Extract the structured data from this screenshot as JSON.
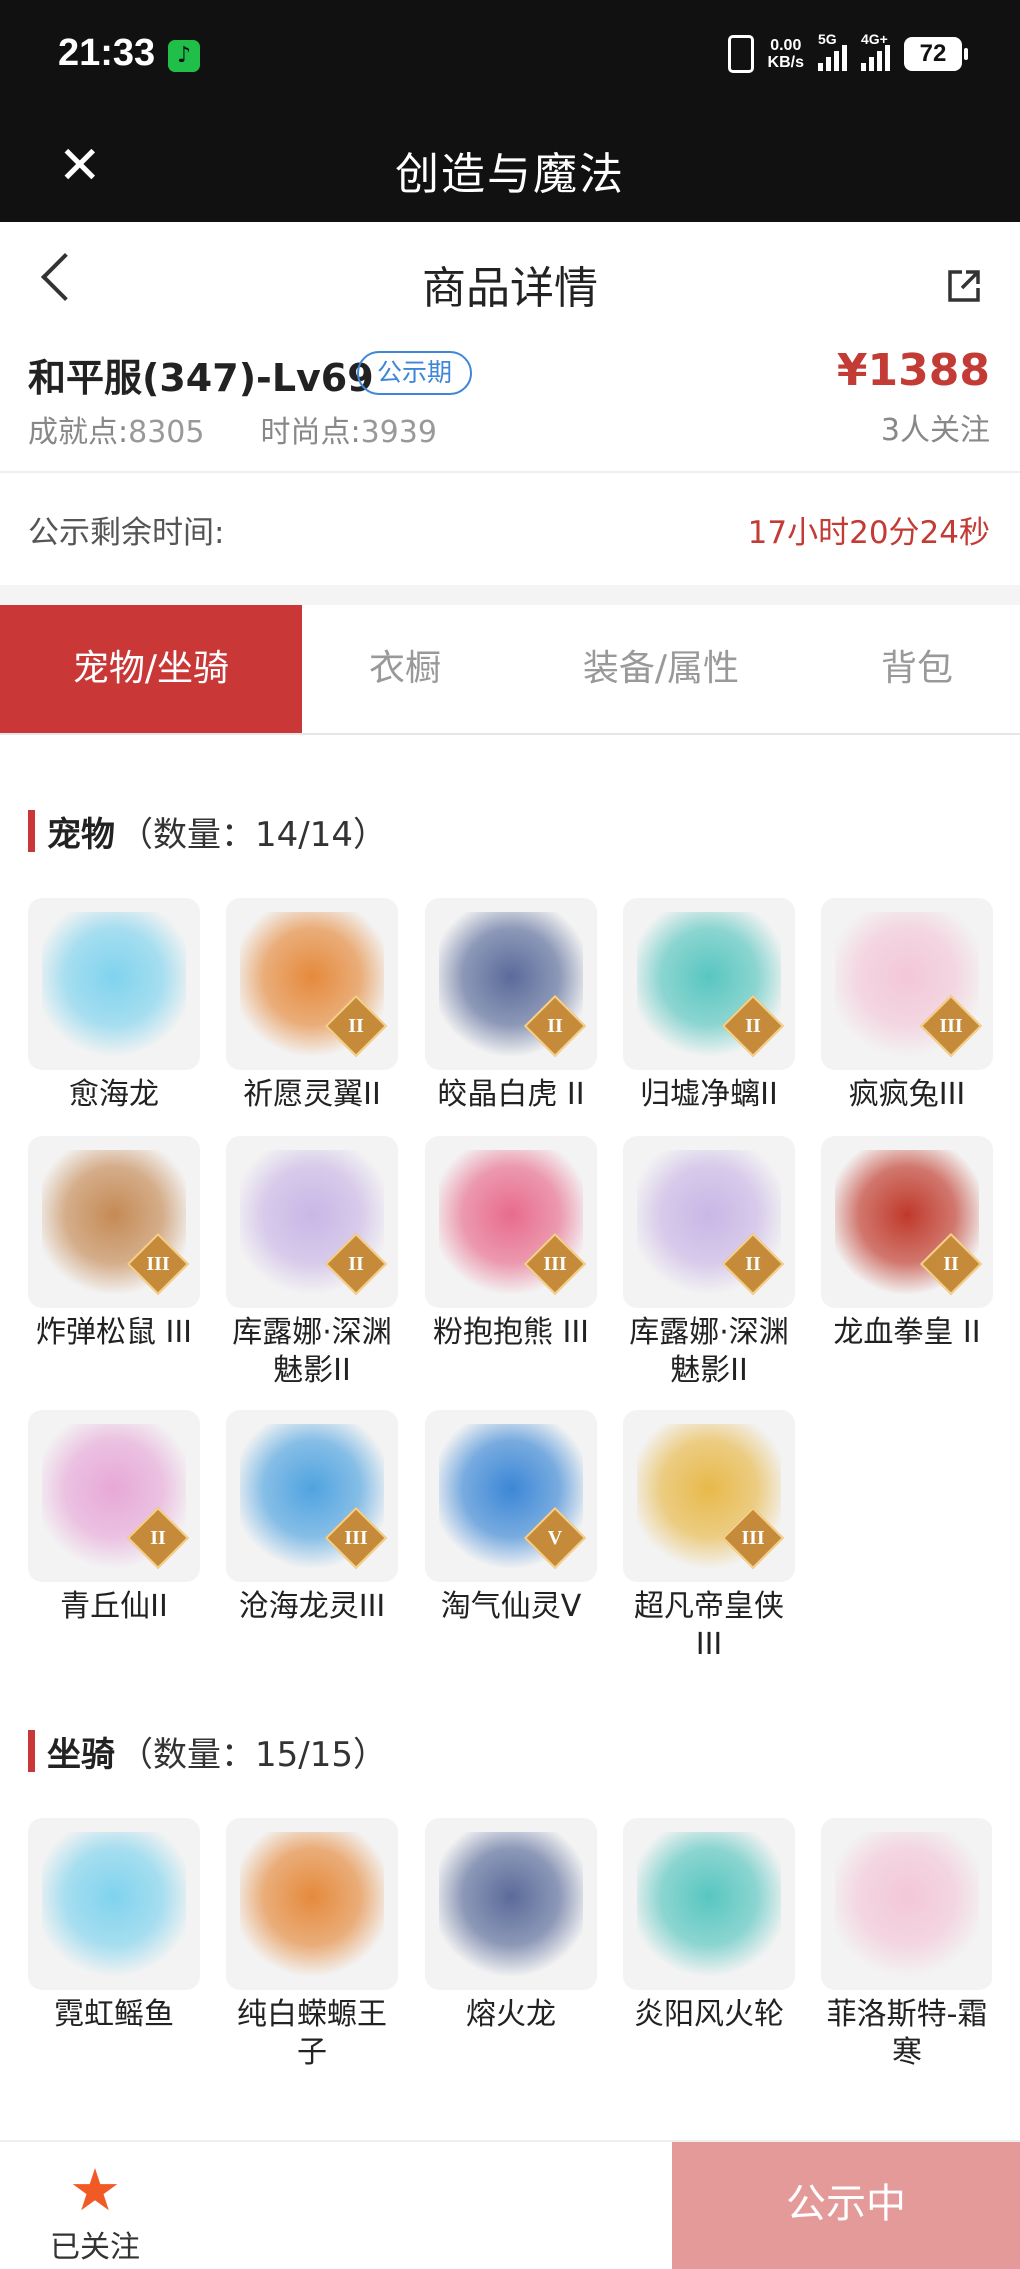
{
  "status_bar": {
    "time": "21:33",
    "net_speed_value": "0.00",
    "net_speed_unit": "KB/s",
    "signal1_label": "5G",
    "signal2_label": "4G+",
    "battery": "72"
  },
  "app_bar": {
    "title": "创造与魔法"
  },
  "nav": {
    "title": "商品详情"
  },
  "summary": {
    "name": "和平服(347)-Lv69",
    "badge": "公示期",
    "achievement_label": "成就点:",
    "achievement_value": "8305",
    "fashion_label": "时尚点:",
    "fashion_value": "3939",
    "price": "¥1388",
    "followers": "3人关注"
  },
  "countdown": {
    "label": "公示剩余时间:",
    "value": "17小时20分24秒"
  },
  "tabs": [
    "宠物/坐骑",
    "衣橱",
    "装备/属性",
    "背包"
  ],
  "pets": {
    "title": "宠物",
    "count": "（数量：14/14）",
    "items": [
      {
        "name": "愈海龙",
        "level": ""
      },
      {
        "name": "祈愿灵翼II",
        "level": "II"
      },
      {
        "name": "皎晶白虎 II",
        "level": "II"
      },
      {
        "name": "归墟净螭II",
        "level": "II"
      },
      {
        "name": "疯疯兔III",
        "level": "III"
      },
      {
        "name": "炸弹松鼠 III",
        "level": "III"
      },
      {
        "name": "库露娜·深渊魅影II",
        "level": "II"
      },
      {
        "name": "粉抱抱熊 III",
        "level": "III"
      },
      {
        "name": "库露娜·深渊魅影II",
        "level": "II"
      },
      {
        "name": "龙血拳皇 II",
        "level": "II"
      },
      {
        "name": "青丘仙II",
        "level": "II"
      },
      {
        "name": "沧海龙灵III",
        "level": "III"
      },
      {
        "name": "淘气仙灵V",
        "level": "V"
      },
      {
        "name": "超凡帝皇侠III",
        "level": "III"
      }
    ]
  },
  "mounts": {
    "title": "坐骑",
    "count": "（数量：15/15）",
    "items": [
      {
        "name": "霓虹鳐鱼"
      },
      {
        "name": "纯白蝾螈王子"
      },
      {
        "name": "熔火龙"
      },
      {
        "name": "炎阳风火轮"
      },
      {
        "name": "菲洛斯特-霜寒"
      }
    ]
  },
  "bottom": {
    "favorite_label": "已关注",
    "cta_label": "公示中"
  },
  "colors": {
    "accent": "#c93836",
    "price": "#c33b35",
    "badge": "#3d86d8",
    "cta": "#e39a98"
  }
}
